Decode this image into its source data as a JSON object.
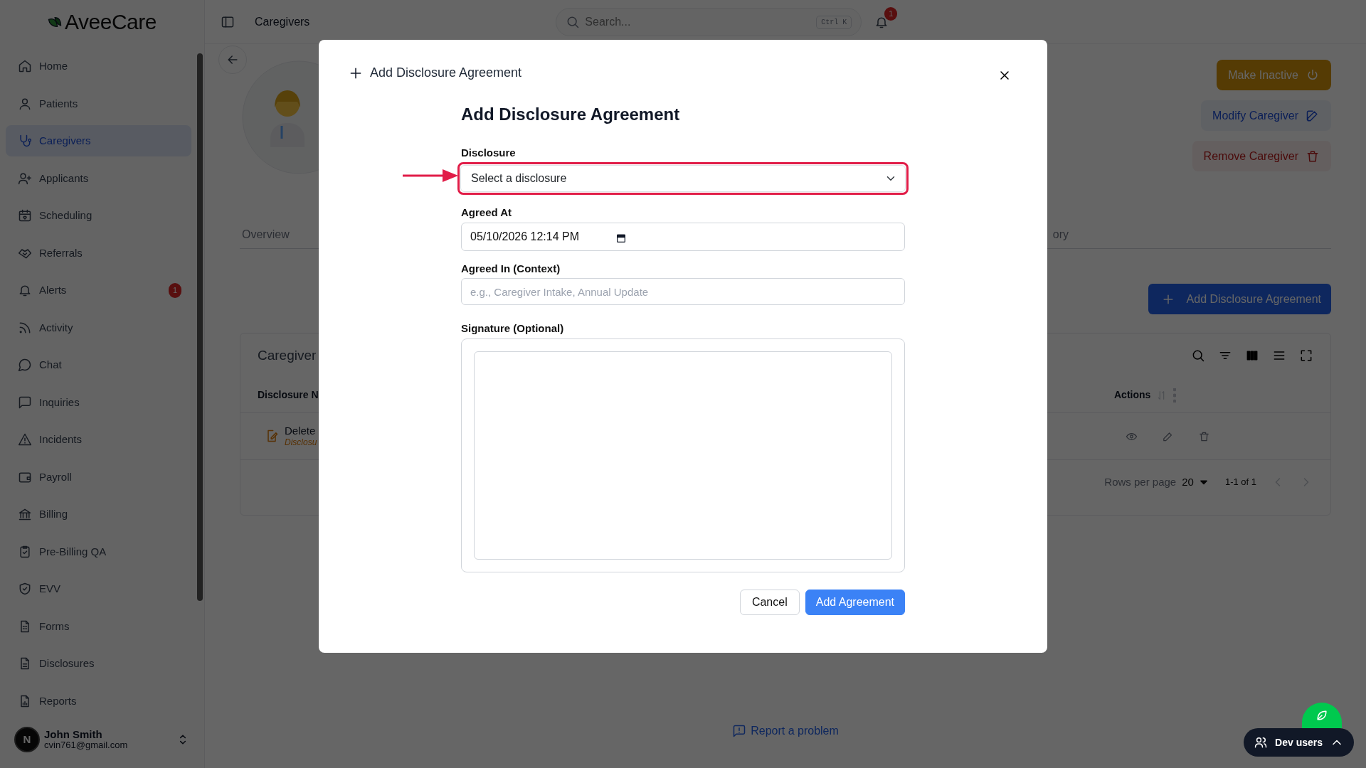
{
  "sidebar": {
    "logo": "AveeCare",
    "items": [
      {
        "label": "Home",
        "selected": false
      },
      {
        "label": "Patients",
        "selected": false
      },
      {
        "label": "Caregivers",
        "selected": true
      },
      {
        "label": "Applicants",
        "selected": false
      },
      {
        "label": "Scheduling",
        "selected": false
      },
      {
        "label": "Referrals",
        "selected": false
      },
      {
        "label": "Alerts",
        "selected": false,
        "badge": "1"
      },
      {
        "label": "Activity",
        "selected": false
      },
      {
        "label": "Chat",
        "selected": false
      },
      {
        "label": "Inquiries",
        "selected": false
      },
      {
        "label": "Incidents",
        "selected": false
      },
      {
        "label": "Payroll",
        "selected": false
      },
      {
        "label": "Billing",
        "selected": false
      },
      {
        "label": "Pre-Billing QA",
        "selected": false
      },
      {
        "label": "EVV",
        "selected": false
      },
      {
        "label": "Forms",
        "selected": false
      },
      {
        "label": "Disclosures",
        "selected": false
      },
      {
        "label": "Reports",
        "selected": false
      }
    ],
    "user": {
      "initial": "N",
      "name": "John Smith",
      "email": "cvin761@gmail.com"
    }
  },
  "topbar": {
    "title": "Caregivers",
    "search": {
      "placeholder": "Search...",
      "shortcut": "Ctrl K"
    },
    "notifications": "1"
  },
  "profile": {
    "actions": [
      {
        "label": "Make Inactive",
        "kind": "warning"
      },
      {
        "label": "Modify Caregiver",
        "kind": "edit"
      },
      {
        "label": "Remove Caregiver",
        "kind": "danger"
      }
    ]
  },
  "tabs": [
    {
      "label": "Overview",
      "selected": false
    },
    {
      "label": "ory",
      "selected": false
    }
  ],
  "add_button": "Add Disclosure Agreement",
  "table": {
    "title": "Caregiver",
    "columns": [
      "Disclosure N",
      "Actions"
    ],
    "rows": [
      {
        "name": "Delete",
        "subtitle": "Disclosu"
      }
    ],
    "rows_per_page_label": "Rows per page",
    "rows_per_page": "20",
    "range": "1-1 of 1"
  },
  "report_link": "Report a problem",
  "dev_users": "Dev users",
  "modal": {
    "header": "Add Disclosure Agreement",
    "heading": "Add Disclosure Agreement",
    "fields": [
      {
        "kind": "select",
        "label": "Disclosure",
        "value": "Select a disclosure",
        "highlighted": true
      },
      {
        "kind": "datetime",
        "label": "Agreed At",
        "value": "05/10/2026 12:14 PM"
      },
      {
        "kind": "text",
        "label": "Agreed In (Context)",
        "placeholder": "e.g., Caregiver Intake, Annual Update"
      },
      {
        "kind": "signature",
        "label": "Signature (Optional)"
      }
    ],
    "buttons": [
      {
        "label": "Cancel",
        "kind": "secondary"
      },
      {
        "label": "Add Agreement",
        "kind": "primary"
      }
    ]
  }
}
